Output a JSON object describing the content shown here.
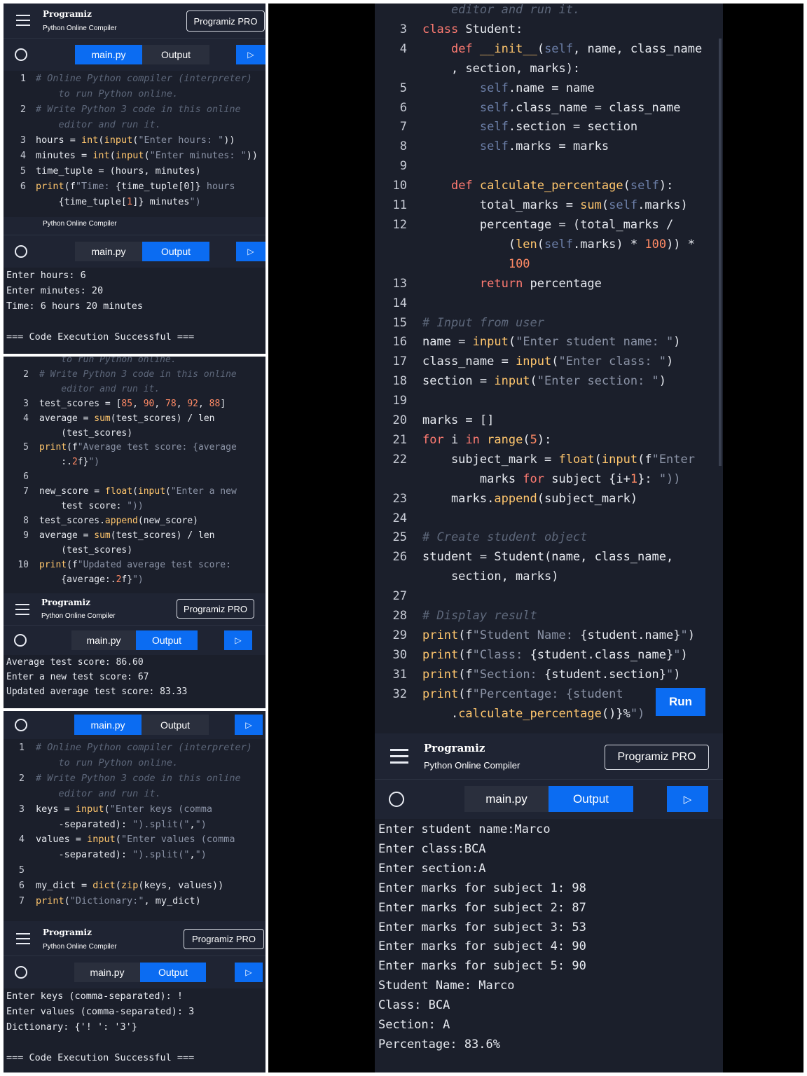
{
  "app": {
    "brand": "Programiz",
    "subtitle": "Python Online Compiler",
    "pro_label": "Programiz PRO",
    "tab_main": "main.py",
    "tab_output": "Output",
    "run_label": "Run"
  },
  "panel1": {
    "code": [
      {
        "n": "1",
        "t": "# Online Python compiler (interpreter)",
        "c": "cm"
      },
      {
        "n": "",
        "t": "    to run Python online.",
        "c": "cm"
      },
      {
        "n": "2",
        "t": "# Write Python 3 code in this online",
        "c": "cm"
      },
      {
        "n": "",
        "t": "    editor and run it.",
        "c": "cm"
      },
      {
        "n": "3",
        "t": "hours = int(input(\"Enter hours: \"))",
        "c": ""
      },
      {
        "n": "4",
        "t": "minutes = int(input(\"Enter minutes: \"))",
        "c": ""
      },
      {
        "n": "5",
        "t": "time_tuple = (hours, minutes)",
        "c": ""
      },
      {
        "n": "6",
        "t": "print(f\"Time: {time_tuple[0]} hours",
        "c": ""
      },
      {
        "n": "",
        "t": "    {time_tuple[1]} minutes\")",
        "c": ""
      }
    ],
    "output": [
      "Enter hours: 6",
      "Enter minutes: 20",
      "Time: 6 hours 20 minutes",
      "",
      "=== Code Execution Successful ==="
    ]
  },
  "panel2": {
    "code": [
      {
        "n": "",
        "t": "    to run Python online.",
        "c": "cm"
      },
      {
        "n": "2",
        "t": "# Write Python 3 code in this online",
        "c": "cm"
      },
      {
        "n": "",
        "t": "    editor and run it.",
        "c": "cm"
      },
      {
        "n": "3",
        "t": "test_scores = [85, 90, 78, 92, 88]",
        "c": ""
      },
      {
        "n": "4",
        "t": "average = sum(test_scores) / len",
        "c": ""
      },
      {
        "n": "",
        "t": "    (test_scores)",
        "c": ""
      },
      {
        "n": "5",
        "t": "print(f\"Average test score: {average",
        "c": ""
      },
      {
        "n": "",
        "t": "    :.2f}\")",
        "c": ""
      },
      {
        "n": "6",
        "t": "",
        "c": ""
      },
      {
        "n": "7",
        "t": "new_score = float(input(\"Enter a new",
        "c": ""
      },
      {
        "n": "",
        "t": "    test score: \"))",
        "c": ""
      },
      {
        "n": "8",
        "t": "test_scores.append(new_score)",
        "c": ""
      },
      {
        "n": "9",
        "t": "average = sum(test_scores) / len",
        "c": ""
      },
      {
        "n": "",
        "t": "    (test_scores)",
        "c": ""
      },
      {
        "n": "10",
        "t": "print(f\"Updated average test score:",
        "c": ""
      },
      {
        "n": "",
        "t": "    {average:.2f}\")",
        "c": ""
      }
    ],
    "output": [
      "Average test score: 86.60",
      "Enter a new test score: 67",
      "Updated average test score: 83.33"
    ]
  },
  "panel3": {
    "code": [
      {
        "n": "1",
        "t": "# Online Python compiler (interpreter)",
        "c": "cm"
      },
      {
        "n": "",
        "t": "    to run Python online.",
        "c": "cm"
      },
      {
        "n": "2",
        "t": "# Write Python 3 code in this online",
        "c": "cm"
      },
      {
        "n": "",
        "t": "    editor and run it.",
        "c": "cm"
      },
      {
        "n": "3",
        "t": "keys = input(\"Enter keys (comma",
        "c": ""
      },
      {
        "n": "",
        "t": "    -separated): \").split(\",\")",
        "c": ""
      },
      {
        "n": "4",
        "t": "values = input(\"Enter values (comma",
        "c": ""
      },
      {
        "n": "",
        "t": "    -separated): \").split(\",\")",
        "c": ""
      },
      {
        "n": "5",
        "t": "",
        "c": ""
      },
      {
        "n": "6",
        "t": "my_dict = dict(zip(keys, values))",
        "c": ""
      },
      {
        "n": "7",
        "t": "print(\"Dictionary:\", my_dict)",
        "c": ""
      }
    ],
    "output": [
      "Enter keys (comma-separated): !",
      "Enter values (comma-separated): 3",
      "Dictionary: {'! ': '3'}",
      "",
      "=== Code Execution Successful ==="
    ]
  },
  "panel4": {
    "code": [
      {
        "n": "",
        "t": "    editor and run it.",
        "c": "cm"
      },
      {
        "n": "3",
        "t": "class Student:",
        "c": ""
      },
      {
        "n": "4",
        "t": "    def __init__(self, name, class_name",
        "c": ""
      },
      {
        "n": "",
        "t": "    , section, marks):",
        "c": ""
      },
      {
        "n": "5",
        "t": "        self.name = name",
        "c": ""
      },
      {
        "n": "6",
        "t": "        self.class_name = class_name",
        "c": ""
      },
      {
        "n": "7",
        "t": "        self.section = section",
        "c": ""
      },
      {
        "n": "8",
        "t": "        self.marks = marks",
        "c": ""
      },
      {
        "n": "9",
        "t": "",
        "c": ""
      },
      {
        "n": "10",
        "t": "    def calculate_percentage(self):",
        "c": ""
      },
      {
        "n": "11",
        "t": "        total_marks = sum(self.marks)",
        "c": ""
      },
      {
        "n": "12",
        "t": "        percentage = (total_marks /",
        "c": ""
      },
      {
        "n": "",
        "t": "            (len(self.marks) * 100)) *",
        "c": ""
      },
      {
        "n": "",
        "t": "            100",
        "c": ""
      },
      {
        "n": "13",
        "t": "        return percentage",
        "c": ""
      },
      {
        "n": "14",
        "t": "",
        "c": ""
      },
      {
        "n": "15",
        "t": "# Input from user",
        "c": "cm"
      },
      {
        "n": "16",
        "t": "name = input(\"Enter student name: \")",
        "c": ""
      },
      {
        "n": "17",
        "t": "class_name = input(\"Enter class: \")",
        "c": ""
      },
      {
        "n": "18",
        "t": "section = input(\"Enter section: \")",
        "c": ""
      },
      {
        "n": "19",
        "t": "",
        "c": ""
      },
      {
        "n": "20",
        "t": "marks = []",
        "c": ""
      },
      {
        "n": "21",
        "t": "for i in range(5):",
        "c": ""
      },
      {
        "n": "22",
        "t": "    subject_mark = float(input(f\"Enter",
        "c": ""
      },
      {
        "n": "",
        "t": "        marks for subject {i+1}: \"))",
        "c": ""
      },
      {
        "n": "23",
        "t": "    marks.append(subject_mark)",
        "c": ""
      },
      {
        "n": "24",
        "t": "",
        "c": ""
      },
      {
        "n": "25",
        "t": "# Create student object",
        "c": "cm"
      },
      {
        "n": "26",
        "t": "student = Student(name, class_name,",
        "c": ""
      },
      {
        "n": "",
        "t": "    section, marks)",
        "c": ""
      },
      {
        "n": "27",
        "t": "",
        "c": ""
      },
      {
        "n": "28",
        "t": "# Display result",
        "c": "cm"
      },
      {
        "n": "29",
        "t": "print(f\"Student Name: {student.name}\")",
        "c": ""
      },
      {
        "n": "30",
        "t": "print(f\"Class: {student.class_name}\")",
        "c": ""
      },
      {
        "n": "31",
        "t": "print(f\"Section: {student.section}\")",
        "c": ""
      },
      {
        "n": "32",
        "t": "print(f\"Percentage: {student",
        "c": ""
      },
      {
        "n": "",
        "t": "    .calculate_percentage()}%\")",
        "c": ""
      }
    ],
    "output": [
      "Enter student name:Marco",
      "Enter class:BCA",
      "Enter section:A",
      "Enter marks for subject 1: 98",
      "Enter marks for subject 2: 87",
      "Enter marks for subject 3: 53",
      "Enter marks for subject 4: 90",
      "Enter marks for subject 5: 90",
      "Student Name: Marco",
      "Class: BCA",
      "Section: A",
      "Percentage: 83.6%"
    ]
  }
}
